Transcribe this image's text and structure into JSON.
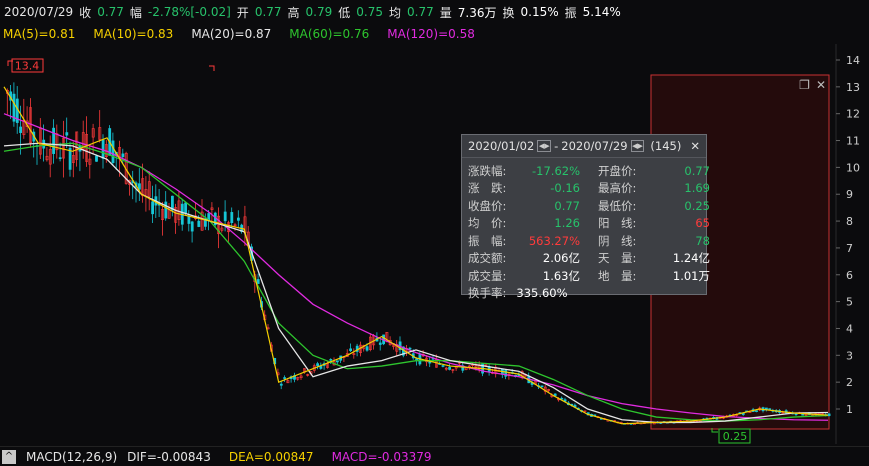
{
  "header": {
    "date": "2020/07/29",
    "close_label": "收",
    "close_value": "0.77",
    "change_label": "幅",
    "change_value": "-2.78%[-0.02]",
    "open_label": "开",
    "open_value": "0.77",
    "high_label": "高",
    "high_value": "0.79",
    "low_label": "低",
    "low_value": "0.75",
    "avg_label": "均",
    "avg_value": "0.77",
    "volume_label": "量",
    "volume_value": "7.36万",
    "turnover_label": "换",
    "turnover_value": "0.15%",
    "amplitude_label": "振",
    "amplitude_value": "5.14%"
  },
  "ma_line": {
    "ma5": "MA(5)=0.81",
    "ma10": "MA(10)=0.83",
    "ma20": "MA(20)=0.87",
    "ma60": "MA(60)=0.76",
    "ma120": "MA(120)=0.58"
  },
  "colors": {
    "ma5": "#ffffff",
    "ma10": "#f5d000",
    "ma20": "#e6e6e6",
    "ma60": "#2ec52e",
    "ma120": "#e02be0",
    "up": "#ff3b3b",
    "down": "#16c6d6"
  },
  "markers": {
    "high": "13.4",
    "low": "0.25"
  },
  "panel": {
    "start_date": "2020/01/02",
    "separator": "-",
    "end_date": "2020/07/29",
    "count": "(145)",
    "rows": [
      {
        "k1": "涨跌幅:",
        "v1": "-17.62%",
        "k2": "开盘价:",
        "v2": "0.77"
      },
      {
        "k1": "涨　跌:",
        "v1": "-0.16",
        "k2": "最高价:",
        "v2": "1.69"
      },
      {
        "k1": "收盘价:",
        "v1": "0.77",
        "k2": "最低价:",
        "v2": "0.25"
      },
      {
        "k1": "均　价:",
        "v1": "1.26",
        "k2": "阳　线:",
        "v2": "65"
      },
      {
        "k1": "振　幅:",
        "v1": "563.27%",
        "k2": "阴　线:",
        "v2": "78"
      },
      {
        "k1": "成交额:",
        "v1": "2.06亿",
        "k2": "天　量:",
        "v2": "1.24亿"
      },
      {
        "k1": "成交量:",
        "v1": "1.63亿",
        "k2": "地　量:",
        "v2": "1.01万"
      }
    ],
    "turnover_label": "换手率:",
    "turnover_value": "335.60%"
  },
  "footer": {
    "caret": "^",
    "macd": "MACD(12,26,9)",
    "dif": "DIF=-0.00843",
    "dea": "DEA=0.00847",
    "macd_value": "MACD=-0.03379"
  },
  "chart_data": {
    "type": "line",
    "y_ticks": [
      "14",
      "13",
      "12",
      "11",
      "10",
      "9",
      "8",
      "7",
      "6",
      "5",
      "4",
      "3",
      "2",
      "1"
    ],
    "ylim": [
      0.2,
      14.4
    ],
    "series": [
      {
        "name": "MA(120)",
        "values": [
          12.0,
          11.5,
          11.0,
          10.6,
          10.0,
          9.2,
          8.3,
          7.2,
          6.0,
          4.9,
          4.2,
          3.6,
          3.1,
          2.7,
          2.4,
          2.2,
          1.9,
          1.5,
          1.2,
          1.0,
          0.85,
          0.72,
          0.65,
          0.6,
          0.58
        ]
      },
      {
        "name": "MA(60)",
        "values": [
          10.6,
          10.8,
          10.9,
          10.5,
          10.0,
          9.0,
          8.0,
          6.5,
          4.2,
          3.0,
          2.5,
          2.6,
          2.8,
          2.8,
          2.7,
          2.6,
          2.1,
          1.5,
          1.0,
          0.7,
          0.6,
          0.55,
          0.6,
          0.7,
          0.76
        ]
      },
      {
        "name": "MA(20)",
        "values": [
          10.8,
          10.9,
          10.8,
          10.3,
          9.0,
          8.4,
          8.0,
          7.6,
          4.0,
          2.2,
          2.6,
          2.8,
          3.2,
          2.8,
          2.6,
          2.4,
          1.8,
          1.0,
          0.6,
          0.5,
          0.5,
          0.55,
          0.7,
          0.85,
          0.87
        ]
      },
      {
        "name": "close",
        "values": [
          13.0,
          10.9,
          10.6,
          11.1,
          9.0,
          8.3,
          8.0,
          7.7,
          2.0,
          2.5,
          3.0,
          3.7,
          2.9,
          2.6,
          2.5,
          2.3,
          1.5,
          0.8,
          0.45,
          0.5,
          0.55,
          0.7,
          1.0,
          0.85,
          0.77
        ]
      }
    ]
  }
}
